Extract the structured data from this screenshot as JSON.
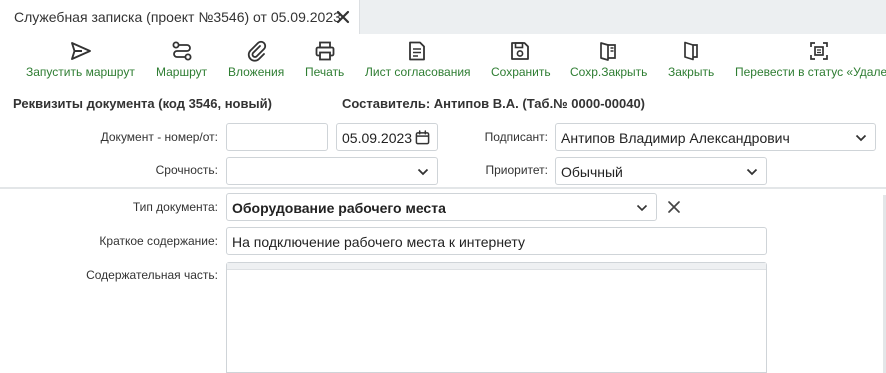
{
  "tab": {
    "title": "Служебная записка (проект №3546) от 05.09.2023"
  },
  "toolbar": {
    "items": [
      {
        "label": "Запустить маршрут",
        "icon": "send-icon"
      },
      {
        "label": "Маршрут",
        "icon": "route-icon"
      },
      {
        "label": "Вложения",
        "icon": "paperclip-icon"
      },
      {
        "label": "Печать",
        "icon": "printer-icon"
      },
      {
        "label": "Лист согласования",
        "icon": "approval-sheet-icon"
      },
      {
        "label": "Сохранить",
        "icon": "save-icon"
      },
      {
        "label": "Сохр.Закрыть",
        "icon": "save-close-icon"
      },
      {
        "label": "Закрыть",
        "icon": "close-book-icon"
      },
      {
        "label": "Перевести в статус «Удален",
        "icon": "status-change-icon"
      }
    ]
  },
  "header": {
    "requisites": "Реквизиты документа (код 3546, новый)",
    "author": "Составитель: Антипов В.А. (Таб.№ 0000-00040)"
  },
  "form": {
    "doc_number_label": "Документ - номер/от:",
    "doc_number_value": "",
    "doc_date_value": "05.09.2023",
    "signer_label": "Подписант:",
    "signer_value": "Антипов Владимир Александрович",
    "urgency_label": "Срочность:",
    "urgency_value": "",
    "priority_label": "Приоритет:",
    "priority_value": "Обычный",
    "doc_type_label": "Тип документа:",
    "doc_type_value": "Оборудование рабочего места",
    "summary_label": "Краткое содержание:",
    "summary_value": "На подключение рабочего места к интернету",
    "content_label": "Содержательная часть:",
    "content_value": ""
  },
  "colors": {
    "accent": "#2e7d32",
    "border": "#cfd4d8",
    "tabbar": "#eceff1"
  }
}
